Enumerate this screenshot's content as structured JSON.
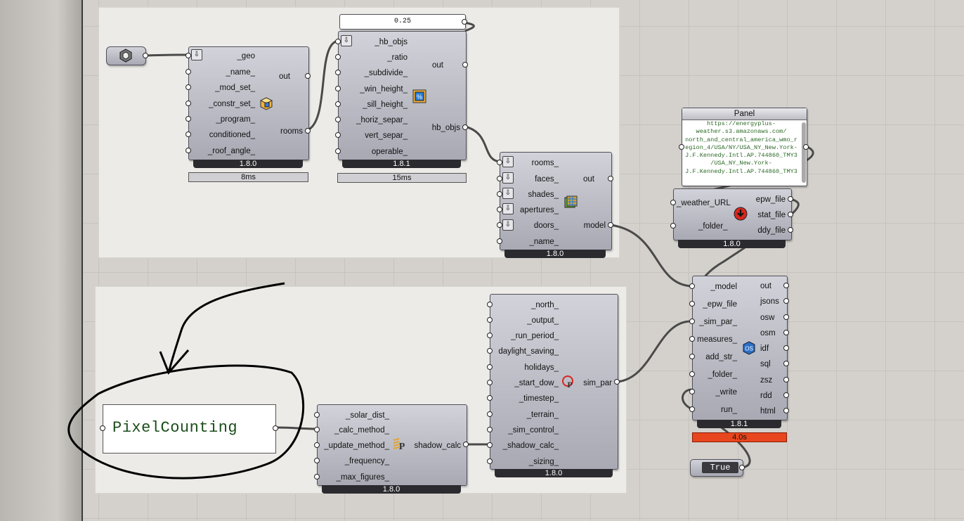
{
  "slider": {
    "value": "0.25"
  },
  "room_comp": {
    "inputs": [
      "_geo",
      "_name_",
      "_mod_set_",
      "_constr_set_",
      "_program_",
      "conditioned_",
      "_roof_angle_"
    ],
    "outputs": [
      "out",
      "rooms"
    ],
    "version": "1.8.0",
    "timing": "8ms",
    "icon": "room-box-icon"
  },
  "aperture_comp": {
    "inputs": [
      "_hb_objs",
      "_ratio",
      "_subdivide_",
      "_win_height_",
      "_sill_height_",
      "_horiz_separ_",
      "vert_separ_",
      "operable_"
    ],
    "outputs": [
      "out",
      "hb_objs"
    ],
    "version": "1.8.1",
    "timing": "15ms",
    "icon": "window-ratio-icon"
  },
  "model_comp": {
    "inputs": [
      "rooms_",
      "faces_",
      "shades_",
      "apertures_",
      "doors_",
      "_name_"
    ],
    "outputs": [
      "out",
      "model"
    ],
    "version": "1.8.0",
    "icon": "model-cube-icon"
  },
  "panel": {
    "title": "Panel",
    "lines": [
      "https://energyplus-",
      "weather.s3.amazonaws.com/",
      "north_and_central_america_wmo_r",
      "egion_4/USA/NY/USA_NY_New.York-",
      "J.F.Kennedy.Intl.AP.744860_TMY3",
      "/USA_NY_New.York-",
      "J.F.Kennedy.Intl.AP.744860_TMY3"
    ]
  },
  "epw_comp": {
    "inputs": [
      "_weather_URL",
      "_folder_"
    ],
    "outputs": [
      "epw_file",
      "stat_file",
      "ddy_file"
    ],
    "version": "1.8.0",
    "icon": "download-weather-icon"
  },
  "osm_comp": {
    "inputs": [
      "_model",
      "_epw_file",
      "_sim_par_",
      "measures_",
      "add_str_",
      "_folder_",
      "_write",
      "run_"
    ],
    "outputs": [
      "out",
      "jsons",
      "osw",
      "osm",
      "idf",
      "sql",
      "zsz",
      "rdd",
      "html"
    ],
    "version": "1.8.1",
    "timing": "4.0s",
    "icon": "openstudio-icon"
  },
  "toggle": {
    "label": "True"
  },
  "simpar_comp": {
    "inputs": [
      "_north_",
      "_output_",
      "_run_period_",
      "daylight_saving_",
      "holidays_",
      "_start_dow_",
      "_timestep_",
      "_terrain_",
      "_sim_control_",
      "_shadow_calc_",
      "_sizing_"
    ],
    "outputs": [
      "sim_par"
    ],
    "version": "1.8.0",
    "icon": "sim-par-icon"
  },
  "shadow_comp": {
    "inputs": [
      "_solar_dist_",
      "_calc_method_",
      "_update_method_",
      "_frequency_",
      "_max_figures_"
    ],
    "outputs": [
      "shadow_calc"
    ],
    "version": "1.8.0",
    "icon": "shadow-calc-icon"
  },
  "text_panel": {
    "text": "PixelCounting"
  }
}
